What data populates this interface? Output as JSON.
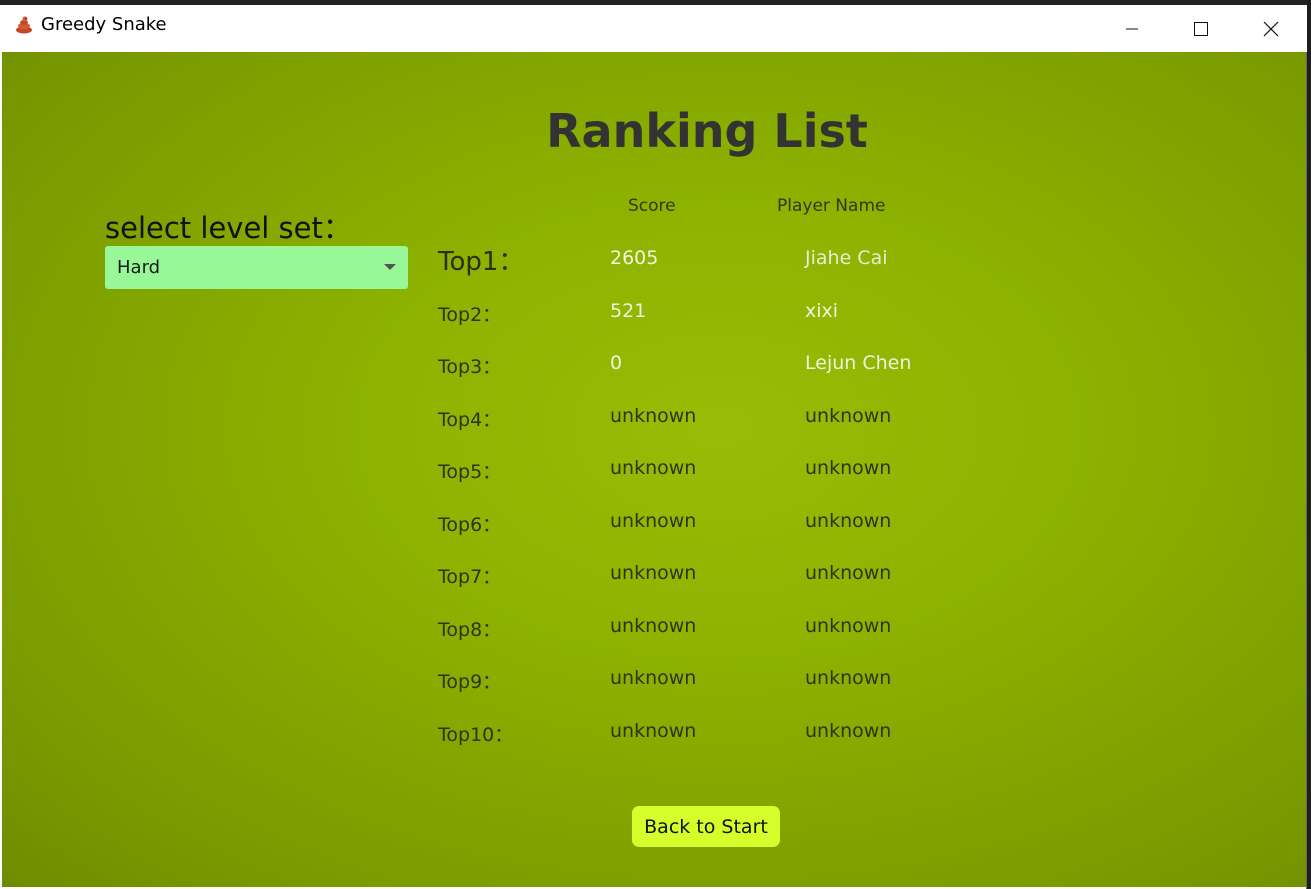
{
  "window": {
    "title": "Greedy Snake",
    "controls": {
      "minimize_icon": "minimize-icon",
      "maximize_icon": "maximize-icon",
      "close_icon": "close-icon"
    }
  },
  "page": {
    "heading": "Ranking List",
    "columns": {
      "score": "Score",
      "player": "Player Name"
    },
    "level": {
      "label": "select level set：",
      "selected": "Hard"
    },
    "rankings": [
      {
        "rank": "Top1：",
        "score": "2605",
        "name": "Jiahe Cai"
      },
      {
        "rank": "Top2：",
        "score": "521",
        "name": "xixi"
      },
      {
        "rank": "Top3：",
        "score": "0",
        "name": "Lejun Chen"
      },
      {
        "rank": "Top4：",
        "score": "unknown",
        "name": "unknown"
      },
      {
        "rank": "Top5：",
        "score": "unknown",
        "name": "unknown"
      },
      {
        "rank": "Top6：",
        "score": "unknown",
        "name": "unknown"
      },
      {
        "rank": "Top7：",
        "score": "unknown",
        "name": "unknown"
      },
      {
        "rank": "Top8：",
        "score": "unknown",
        "name": "unknown"
      },
      {
        "rank": "Top9：",
        "score": "unknown",
        "name": "unknown"
      },
      {
        "rank": "Top10：",
        "score": "unknown",
        "name": "unknown"
      }
    ],
    "back_button": "Back to Start"
  },
  "colors": {
    "background": "#8db200",
    "select": "#98f898",
    "button": "#d4ff2a",
    "heading": "#333333"
  }
}
